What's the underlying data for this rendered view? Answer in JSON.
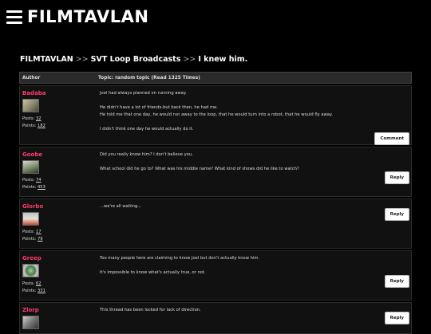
{
  "header": {
    "logo": "FILMTAVLAN"
  },
  "breadcrumb": [
    "FILMTAVLAN",
    "SVT Loop Broadcasts",
    "I knew him."
  ],
  "breadcrumb_sep": ">>",
  "table": {
    "author_header": "Author",
    "topic_header": "Topic: random topic  (Read 1325 Times)"
  },
  "posts": [
    {
      "user": "Badaba",
      "posts_label": "Posts:",
      "posts": "32",
      "points_label": "Points:",
      "points": "182",
      "lines": [
        "Joel had always planned on running away.",
        "He didn't have a lot of friends-but back then, he had me.",
        "He told me that one day, he would run away to the loop, that he would turn into a robot, that he would fly away.",
        "I didn't think one day he would actually do it."
      ],
      "button": "Comment"
    },
    {
      "user": "Goobe",
      "posts_label": "Posts:",
      "posts": "74",
      "points_label": "Points:",
      "points": "453",
      "lines": [
        "Did you really know him? I don't believe you.",
        "What school did he go to? What was his middle name? What kind of shows did he like to watch?"
      ],
      "button": "Reply"
    },
    {
      "user": "Glorbo",
      "posts_label": "Posts:",
      "posts": "17",
      "points_label": "Points:",
      "points": "79",
      "lines": [
        "...we're all waiting..."
      ],
      "button": "Reply"
    },
    {
      "user": "Greep",
      "posts_label": "Posts:",
      "posts": "62",
      "points_label": "Points:",
      "points": "331",
      "lines": [
        "Too many people here are claiming to know Joel but don't actually know him.",
        "It's impossible to know what's actually true, or not."
      ],
      "button": "Reply"
    },
    {
      "user": "Zlorp",
      "posts_label": "",
      "posts": "",
      "points_label": "",
      "points": "",
      "lines": [
        "This thread has been locked for lack of direction."
      ],
      "button": "Reply"
    }
  ],
  "colors": {
    "username": "#ff3b6b",
    "background": "#000000",
    "row": "#111111"
  }
}
